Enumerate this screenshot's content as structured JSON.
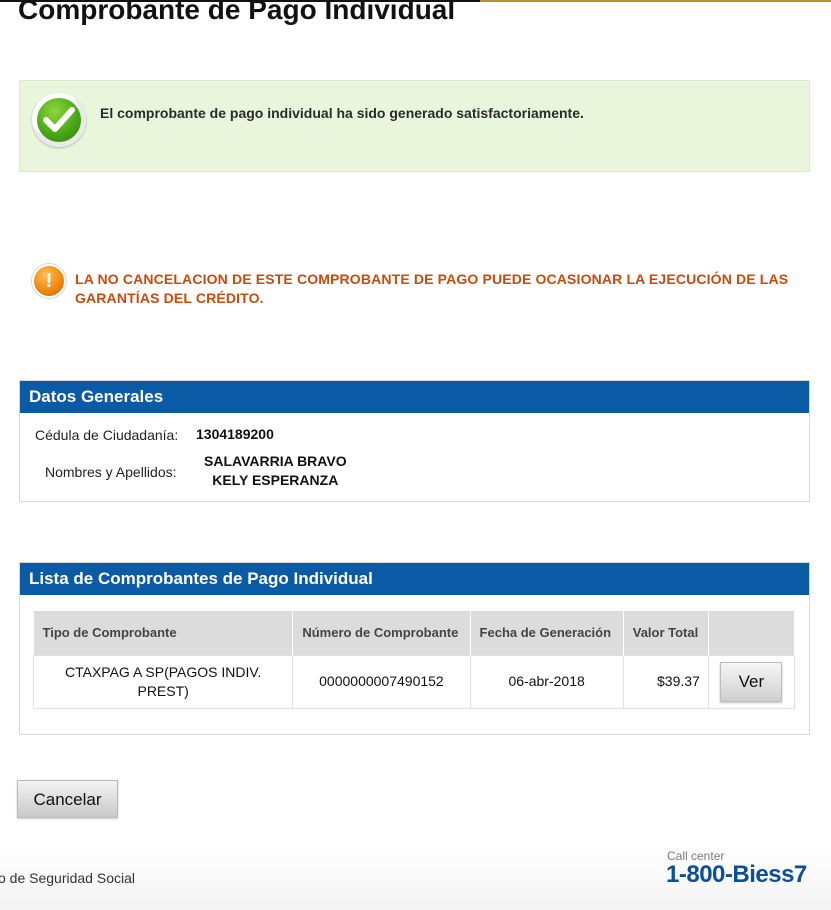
{
  "page": {
    "title": "Comprobante de Pago Individual"
  },
  "success_message": "El comprobante de pago individual ha sido generado satisfactoriamente.",
  "warning_message": "LA NO CANCELACION DE ESTE COMPROBANTE DE PAGO PUEDE OCASIONAR LA EJECUCIÓN DE LAS GARANTÍAS DEL CRÉDITO.",
  "datos_generales": {
    "heading": "Datos Generales",
    "cedula_label": "Cédula de Ciudadanía:",
    "cedula_value": "1304189200",
    "nombres_label": "Nombres y Apellidos:",
    "nombres_line1": "SALAVARRIA BRAVO",
    "nombres_line2": "KELY ESPERANZA"
  },
  "lista": {
    "heading": "Lista de Comprobantes de Pago Individual",
    "columns": [
      "Tipo de Comprobante",
      "Número de Comprobante",
      "Fecha de Generación",
      "Valor Total",
      ""
    ],
    "rows": [
      {
        "tipo": "CTAXPAG A SP(PAGOS INDIV. PREST)",
        "numero": "0000000007490152",
        "fecha": "06-abr-2018",
        "valor": "$39.37",
        "action_label": "Ver"
      }
    ]
  },
  "actions": {
    "cancel_label": "Cancelar"
  },
  "footer": {
    "org_text": "o de Seguridad Social",
    "callcenter_label": "Call center",
    "callcenter_number": "1-800-Biess7"
  },
  "icons": {
    "success": "check-circle-icon",
    "warning": "exclamation-circle-icon"
  },
  "colors": {
    "panel_header": "#0a5aa6",
    "success_bg": "#e9f6dc",
    "warning_text": "#c94a0c",
    "callcenter": "#0a4f9a"
  }
}
